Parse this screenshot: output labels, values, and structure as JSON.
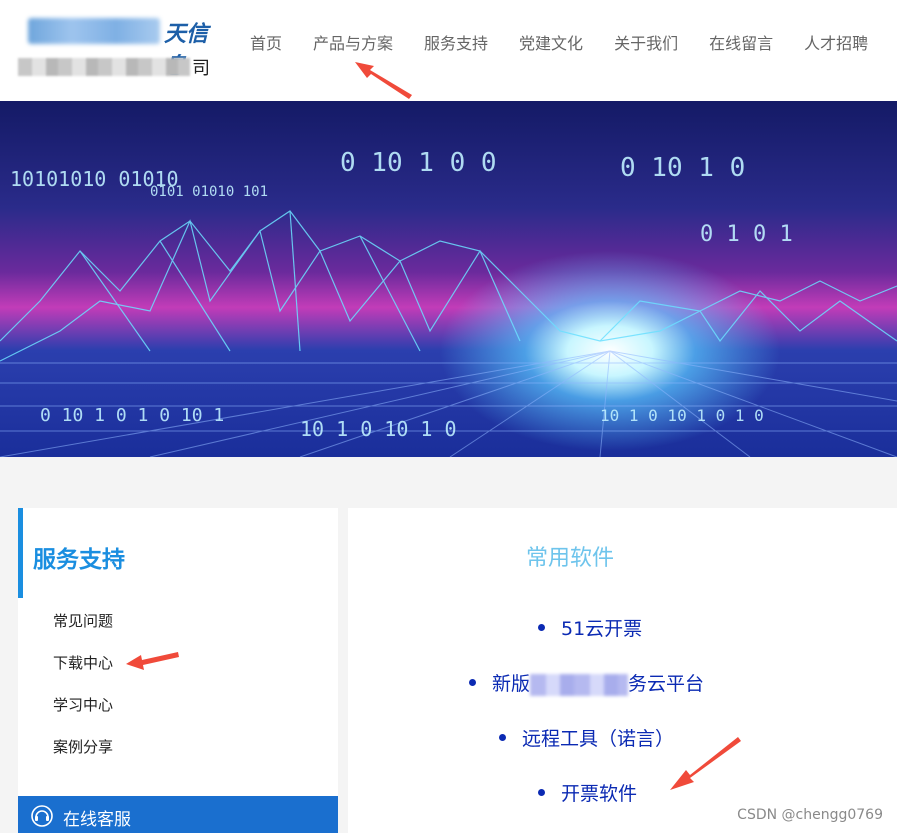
{
  "header": {
    "logo_text_line1": "天信息",
    "logo_text_line2": "司",
    "nav": [
      "首页",
      "产品与方案",
      "服务支持",
      "党建文化",
      "关于我们",
      "在线留言",
      "人才招聘"
    ]
  },
  "sidebar": {
    "title": "服务支持",
    "items": [
      "常见问题",
      "下载中心",
      "学习中心",
      "案例分享"
    ],
    "customer_service": "在线客服"
  },
  "main": {
    "title": "常用软件",
    "downloads": [
      {
        "label": "51云开票"
      },
      {
        "prefix": "新版",
        "suffix": "务云平台"
      },
      {
        "label": "远程工具（诺言）"
      },
      {
        "label": "开票软件"
      }
    ]
  },
  "watermark": "CSDN @chengg0769",
  "colors": {
    "accent": "#1a8ee0",
    "link": "#0b2ab3",
    "arrow": "#f04a3a"
  }
}
